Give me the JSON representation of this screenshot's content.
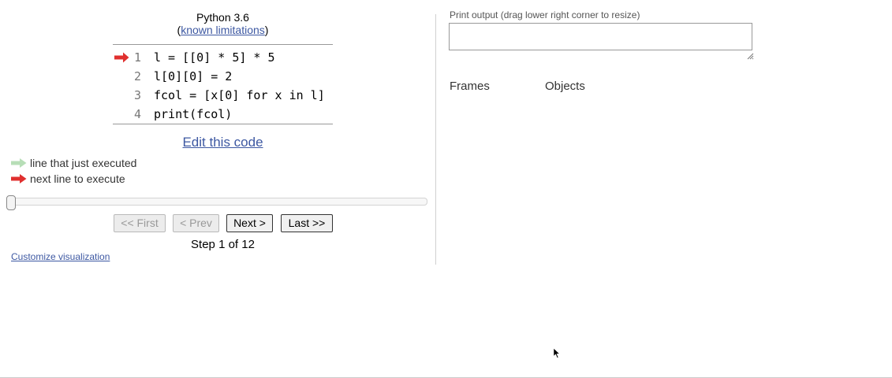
{
  "header": {
    "language": "Python 3.6",
    "limitations_open": "(",
    "limitations_link": "known limitations",
    "limitations_close": ")"
  },
  "code": {
    "lines": [
      {
        "number": "1",
        "text": "l = [[0] * 5] * 5"
      },
      {
        "number": "2",
        "text": "l[0][0] = 2"
      },
      {
        "number": "3",
        "text": "fcol = [x[0] for x in l]"
      },
      {
        "number": "4",
        "text": "print(fcol)"
      }
    ],
    "next_line_marker": "right-arrow-red-icon"
  },
  "edit_link": "Edit this code",
  "legend": {
    "executed": "line that just executed",
    "next": "next line to execute",
    "executed_color": "#b7deb7",
    "next_color": "#e0302f"
  },
  "slider": {
    "current_step": 1,
    "total_steps": 12
  },
  "nav": {
    "first": "<< First",
    "prev": "< Prev",
    "next": "Next >",
    "last": "Last >>"
  },
  "step_label": "Step 1 of 12",
  "customize_link": "Customize visualization",
  "print_output": {
    "label": "Print output (drag lower right corner to resize)",
    "value": ""
  },
  "viz": {
    "frames_header": "Frames",
    "objects_header": "Objects"
  },
  "colors": {
    "link": "#3d58a2",
    "arrow_red": "#e0302f",
    "arrow_green": "#b7deb7"
  }
}
